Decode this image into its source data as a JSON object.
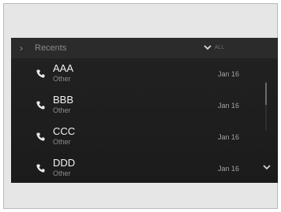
{
  "header": {
    "title": "Recents",
    "filter_label": "ALL",
    "chevron_glyph": "›",
    "expand_icon": "chevron-down-icon"
  },
  "contacts": [
    {
      "name": "AAA",
      "type": "Other",
      "date": "Jan 16"
    },
    {
      "name": "BBB",
      "type": "Other",
      "date": "Jan 16"
    },
    {
      "name": "CCC",
      "type": "Other",
      "date": "Jan 16"
    },
    {
      "name": "DDD",
      "type": "Other",
      "date": "Jan 16"
    }
  ],
  "icons": {
    "row": "phone-icon",
    "scroll": "chevron-down-icon"
  },
  "colors": {
    "screen": "#1e1e1e",
    "header": "#2b2b2b",
    "name_text": "#f2f2f2",
    "secondary_text": "#8c8c8c"
  }
}
